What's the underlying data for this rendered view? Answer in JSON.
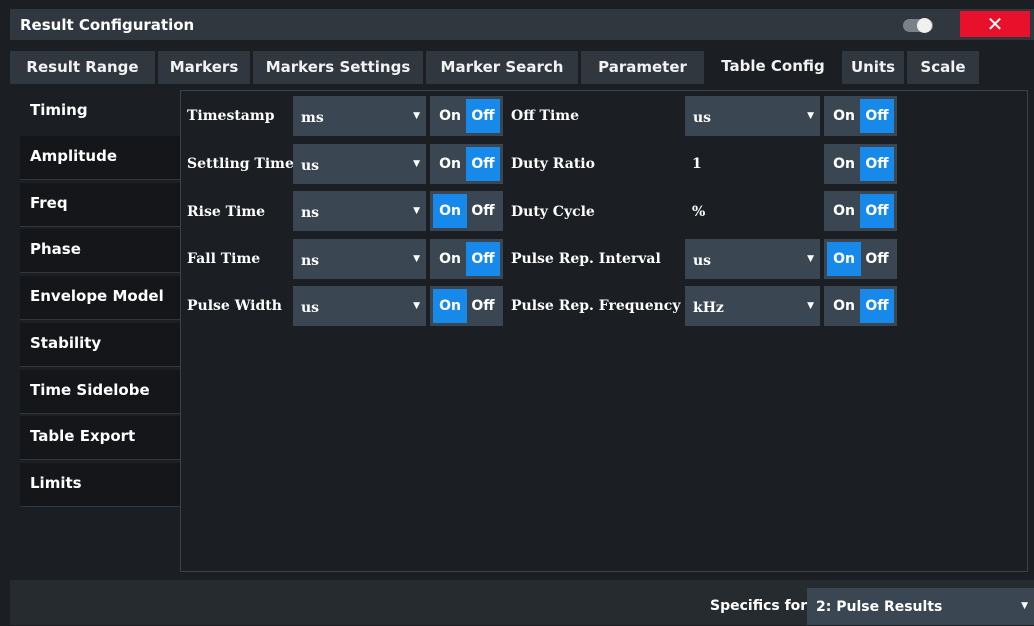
{
  "window": {
    "title": "Result Configuration",
    "close_label": "✕"
  },
  "tabs": [
    {
      "label": "Result Range"
    },
    {
      "label": "Markers"
    },
    {
      "label": "Markers Settings"
    },
    {
      "label": "Marker Search"
    },
    {
      "label": "Parameter"
    },
    {
      "label": "Table Config",
      "active": true
    },
    {
      "label": "Units"
    },
    {
      "label": "Scale"
    }
  ],
  "sidebar": {
    "items": [
      {
        "label": "Timing",
        "active": true
      },
      {
        "label": "Amplitude"
      },
      {
        "label": "Freq"
      },
      {
        "label": "Phase"
      },
      {
        "label": "Envelope Model"
      },
      {
        "label": "Stability"
      },
      {
        "label": "Time Sidelobe"
      },
      {
        "label": "Table Export"
      },
      {
        "label": "Limits"
      }
    ]
  },
  "on_label": "On",
  "off_label": "Off",
  "left_rows": [
    {
      "label": "Timestamp",
      "unit": "ms",
      "state": "Off"
    },
    {
      "label": "Settling Time",
      "unit": "us",
      "state": "Off"
    },
    {
      "label": "Rise Time",
      "unit": "ns",
      "state": "On"
    },
    {
      "label": "Fall Time",
      "unit": "ns",
      "state": "Off"
    },
    {
      "label": "Pulse Width",
      "unit": "us",
      "state": "On"
    }
  ],
  "right_rows": [
    {
      "label": "Off Time",
      "unit": "us",
      "unit_is_dropdown": true,
      "state": "Off"
    },
    {
      "label": "Duty Ratio",
      "unit": "1",
      "unit_is_dropdown": false,
      "state": "Off"
    },
    {
      "label": "Duty Cycle",
      "unit": "%",
      "unit_is_dropdown": false,
      "state": "Off"
    },
    {
      "label": "Pulse Rep. Interval",
      "unit": "us",
      "unit_is_dropdown": true,
      "state": "On"
    },
    {
      "label": "Pulse Rep. Frequency",
      "unit": "kHz",
      "unit_is_dropdown": true,
      "state": "Off"
    }
  ],
  "footer": {
    "specifics_label": "Specifics for",
    "specifics_value": "2: Pulse Results"
  },
  "colors": {
    "accent": "#1789ea",
    "close": "#e8102b"
  }
}
